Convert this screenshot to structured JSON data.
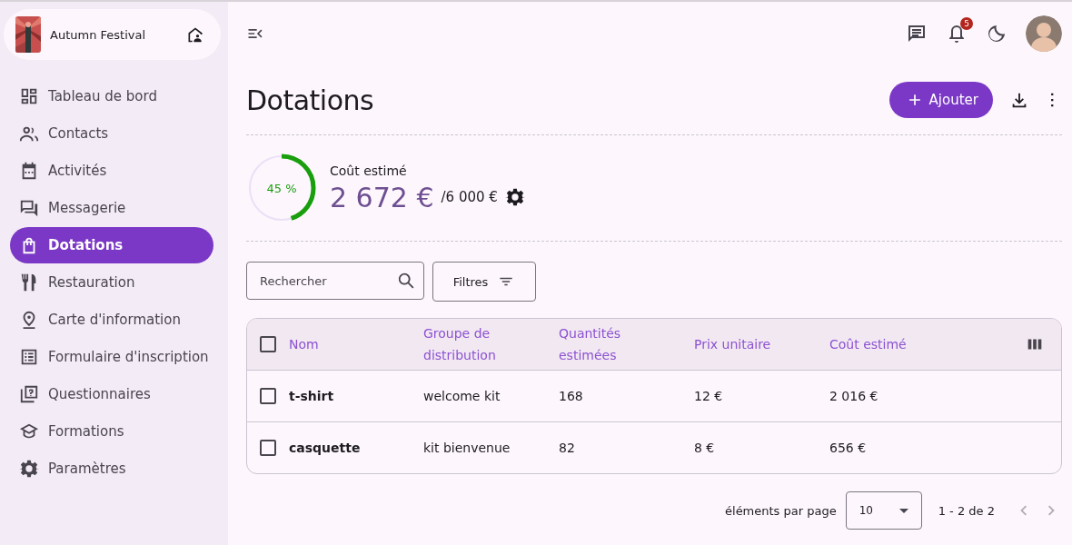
{
  "event": {
    "name": "Autumn Festival"
  },
  "nav": [
    {
      "label": "Tableau de bord",
      "selected": false
    },
    {
      "label": "Contacts",
      "selected": false
    },
    {
      "label": "Activités",
      "selected": false
    },
    {
      "label": "Messagerie",
      "selected": false
    },
    {
      "label": "Dotations",
      "selected": true
    },
    {
      "label": "Restauration",
      "selected": false
    },
    {
      "label": "Carte d'information",
      "selected": false
    },
    {
      "label": "Formulaire d'inscription",
      "selected": false
    },
    {
      "label": "Questionnaires",
      "selected": false
    },
    {
      "label": "Formations",
      "selected": false
    },
    {
      "label": "Paramètres",
      "selected": false
    }
  ],
  "header": {
    "notification_count": "5"
  },
  "page": {
    "title": "Dotations",
    "add_button": "Ajouter"
  },
  "budget": {
    "percent": "45 %",
    "level": 0.45,
    "label": "Coût estimé",
    "amount": "2 672 €",
    "limit": "/6 000 €"
  },
  "search": {
    "placeholder": "Rechercher"
  },
  "filters": {
    "label": "Filtres"
  },
  "table": {
    "all_selected": false,
    "columns": [
      "Nom",
      "Groupe de distribution",
      "Quantités estimées",
      "Prix unitaire",
      "Coût estimé"
    ],
    "rows": [
      {
        "selected": false,
        "cells": [
          "t-shirt",
          "welcome kit",
          "168",
          "12 €",
          "2 016 €"
        ]
      },
      {
        "selected": false,
        "cells": [
          "casquette",
          "kit bienvenue",
          "82",
          "8 €",
          "656 €"
        ]
      }
    ]
  },
  "pagination": {
    "label": "éléments par page",
    "page_size": "10",
    "range": "1 - 2 de 2"
  }
}
